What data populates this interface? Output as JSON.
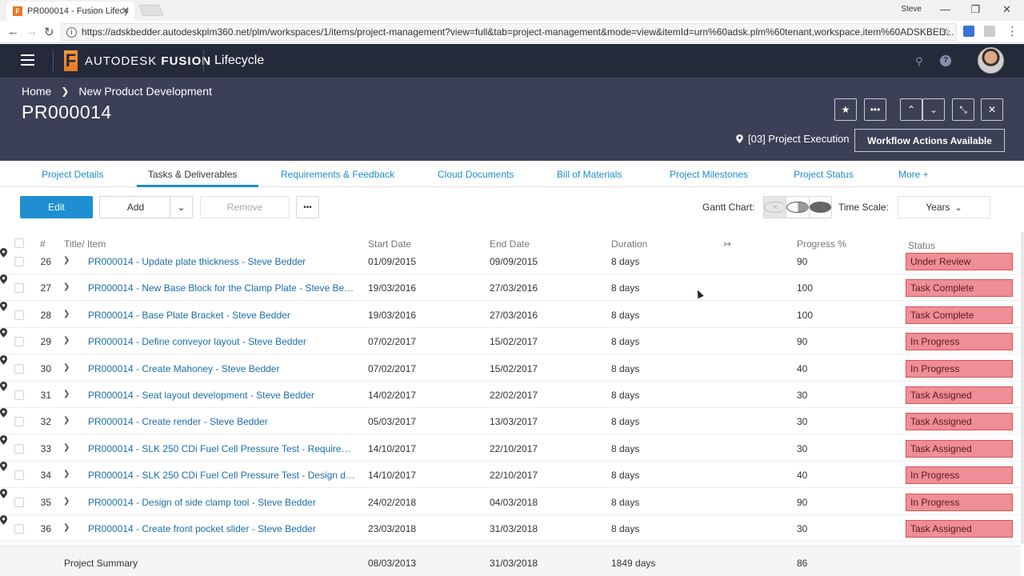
{
  "browser": {
    "tab_title": "PR000014 - Fusion Lifecy",
    "tab_favicon": "F",
    "window_user": "Steve",
    "url": "https://adskbedder.autodeskplm360.net/plm/workspaces/1/items/project-management?view=full&tab=project-management&mode=view&itemId=urn%60adsk.plm%60tenant,workspace,item%60ADSKBED..."
  },
  "app": {
    "brand": "AUTODESK",
    "brand_bold": "FUSION",
    "product": "Lifecycle"
  },
  "item": {
    "breadcrumb": [
      "Home",
      "New Product Development"
    ],
    "title": "PR000014",
    "workflow_state": "[03] Project Execution",
    "workflow_button": "Workflow Actions Available"
  },
  "tabs": [
    {
      "label": "Project Details",
      "active": false
    },
    {
      "label": "Tasks & Deliverables",
      "active": true
    },
    {
      "label": "Requirements & Feedback",
      "active": false
    },
    {
      "label": "Cloud Documents",
      "active": false
    },
    {
      "label": "Bill of Materials",
      "active": false
    },
    {
      "label": "Project Milestones",
      "active": false
    },
    {
      "label": "Project Status",
      "active": false
    },
    {
      "label": "More +",
      "active": false
    }
  ],
  "toolbar": {
    "edit": "Edit",
    "add": "Add",
    "remove": "Remove",
    "gantt_label": "Gantt Chart:",
    "timescale_label": "Time Scale:",
    "timescale_value": "Years"
  },
  "table": {
    "headers": {
      "num": "#",
      "title": "Title/ Item",
      "start": "Start Date",
      "end": "End Date",
      "duration": "Duration",
      "progress": "Progress %",
      "status": "Status"
    },
    "rows": [
      {
        "num": "26",
        "title": "PR000014 - Update plate thickness - Steve Bedder",
        "start": "01/09/2015",
        "end": "09/09/2015",
        "duration": "8 days",
        "progress": "90",
        "status": "Under Review"
      },
      {
        "num": "27",
        "title": "PR000014 - New Base Block for the Clamp Plate - Steve Bed...",
        "start": "19/03/2016",
        "end": "27/03/2016",
        "duration": "8 days",
        "progress": "100",
        "status": "Task Complete"
      },
      {
        "num": "28",
        "title": "PR000014 - Base Plate Bracket - Steve Bedder",
        "start": "19/03/2016",
        "end": "27/03/2016",
        "duration": "8 days",
        "progress": "100",
        "status": "Task Complete"
      },
      {
        "num": "29",
        "title": "PR000014 - Define conveyor layout - Steve Bedder",
        "start": "07/02/2017",
        "end": "15/02/2017",
        "duration": "8 days",
        "progress": "90",
        "status": "In Progress"
      },
      {
        "num": "30",
        "title": "PR000014 - Create Mahoney - Steve Bedder",
        "start": "07/02/2017",
        "end": "15/02/2017",
        "duration": "8 days",
        "progress": "40",
        "status": "In Progress"
      },
      {
        "num": "31",
        "title": "PR000014 - Seat layout development - Steve Bedder",
        "start": "14/02/2017",
        "end": "22/02/2017",
        "duration": "8 days",
        "progress": "30",
        "status": "Task Assigned"
      },
      {
        "num": "32",
        "title": "PR000014 - Create render - Steve Bedder",
        "start": "05/03/2017",
        "end": "13/03/2017",
        "duration": "8 days",
        "progress": "30",
        "status": "Task Assigned"
      },
      {
        "num": "33",
        "title": "PR000014 - SLK 250 CDi Fuel Cell Pressure Test - Requireme...",
        "start": "14/10/2017",
        "end": "22/10/2017",
        "duration": "8 days",
        "progress": "30",
        "status": "Task Assigned"
      },
      {
        "num": "34",
        "title": "PR000014 - SLK 250 CDi Fuel Cell Pressure Test - Design dev...",
        "start": "14/10/2017",
        "end": "22/10/2017",
        "duration": "8 days",
        "progress": "40",
        "status": "In Progress"
      },
      {
        "num": "35",
        "title": "PR000014 - Design of side clamp tool - Steve Bedder",
        "start": "24/02/2018",
        "end": "04/03/2018",
        "duration": "8 days",
        "progress": "90",
        "status": "In Progress"
      },
      {
        "num": "36",
        "title": "PR000014 - Create front pocket slider - Steve Bedder",
        "start": "23/03/2018",
        "end": "31/03/2018",
        "duration": "8 days",
        "progress": "30",
        "status": "Task Assigned"
      }
    ],
    "summary": {
      "label": "Project Summary",
      "start": "08/03/2013",
      "end": "31/03/2018",
      "duration": "1849 days",
      "progress": "86"
    }
  },
  "colors": {
    "app_header": "#252a3a",
    "item_header": "#3b4056",
    "accent": "#1f8fd1",
    "status_bg": "#ef8e97"
  }
}
